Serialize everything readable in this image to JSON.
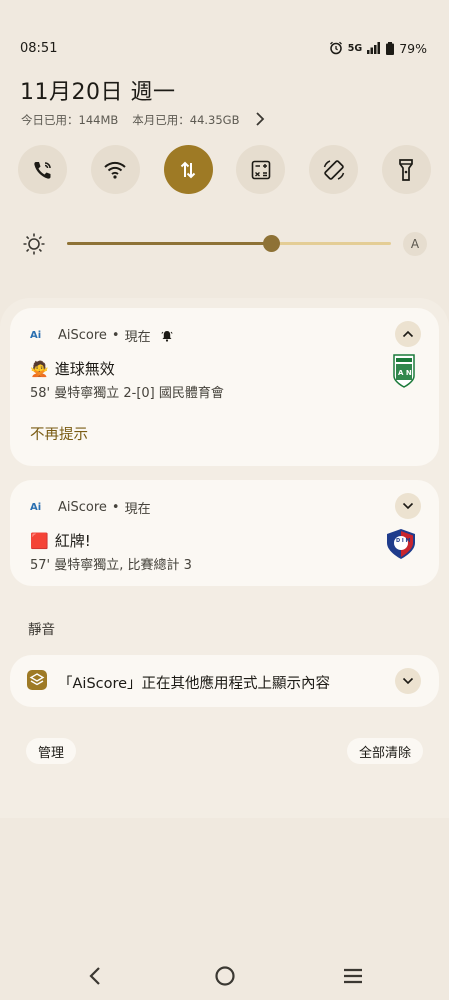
{
  "status": {
    "time": "08:51",
    "network": "5G",
    "battery": "79%"
  },
  "header": {
    "date": "11月20日 週一",
    "today_usage": "今日已用：144MB",
    "month_usage": "本月已用：44.35GB"
  },
  "quick_settings": {
    "tiles": [
      "phone-wifi-calling-icon",
      "wifi-icon",
      "mobile-data-icon",
      "calculator-icon",
      "auto-rotate-icon",
      "flashlight-icon"
    ],
    "active_tile": "mobile-data-icon",
    "accent_color": "#9e7a25"
  },
  "brightness": {
    "level_percent": 63,
    "auto_label": "A"
  },
  "notifications": [
    {
      "app_icon_text": "Ai",
      "app_name": "AiScore",
      "time_label": "現在",
      "emoji": "🙅",
      "title": "進球無效",
      "text": "58' 曼特寧獨立 2-[0] 國民體育會",
      "action": "不再提示"
    },
    {
      "app_icon_text": "Ai",
      "app_name": "AiScore",
      "time_label": "現在",
      "emoji": "🟥",
      "title": "紅牌!",
      "text": "57' 曼特寧獨立, 比賽總計 3"
    }
  ],
  "silent_section": {
    "label": "靜音",
    "overlay_text": "「AiScore」正在其他應用程式上顯示內容"
  },
  "footer": {
    "manage": "管理",
    "clear_all": "全部清除"
  },
  "logos": {
    "nacional_initials": "A N",
    "medellin_initials": "D I M"
  }
}
